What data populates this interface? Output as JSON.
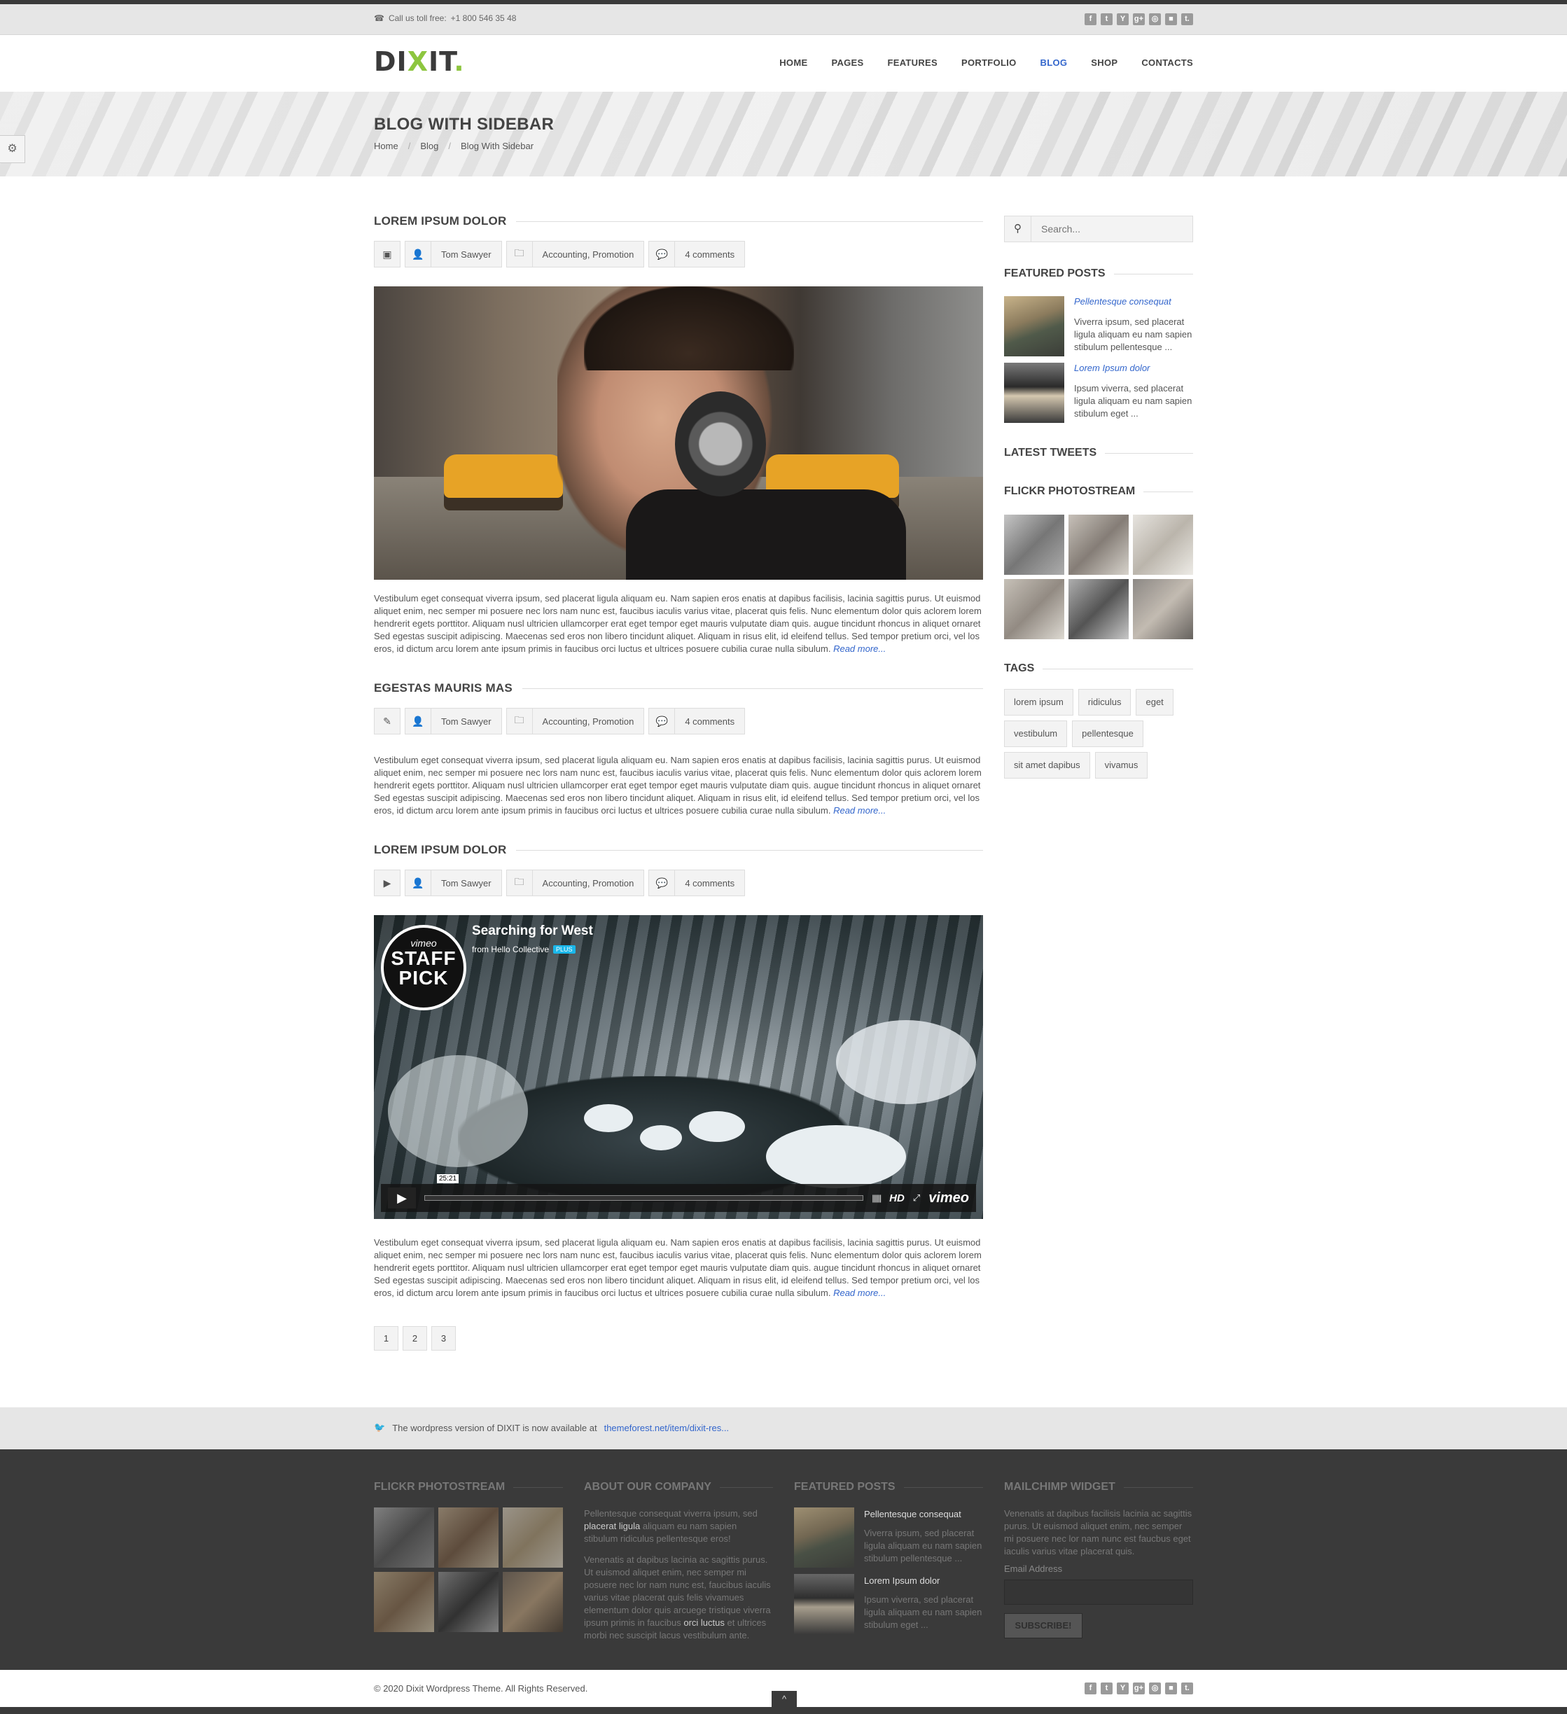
{
  "topbar": {
    "call_label": "Call us toll free:",
    "phone": "+1 800 546 35 48",
    "social": [
      {
        "icon": "facebook-icon",
        "glyph": "f"
      },
      {
        "icon": "twitter-icon",
        "glyph": "t"
      },
      {
        "icon": "youtube-icon",
        "glyph": "Y"
      },
      {
        "icon": "google-plus-icon",
        "glyph": "g+"
      },
      {
        "icon": "dribbble-icon",
        "glyph": "◎"
      },
      {
        "icon": "delicious-icon",
        "glyph": "■"
      },
      {
        "icon": "tumblr-icon",
        "glyph": "t."
      }
    ]
  },
  "header": {
    "logo": "DIXIT.",
    "nav": [
      "HOME",
      "PAGES",
      "FEATURES",
      "PORTFOLIO",
      "BLOG",
      "SHOP",
      "CONTACTS"
    ],
    "active_nav": "BLOG",
    "accent": "#3366cc",
    "brand_green": "#8dc63f"
  },
  "banner": {
    "title": "BLOG WITH SIDEBAR",
    "breadcrumb": [
      "Home",
      "Blog",
      "Blog With Sidebar"
    ]
  },
  "posts": [
    {
      "title": "LOREM IPSUM DOLOR",
      "format_icon": "image-icon",
      "author": "Tom Sawyer",
      "categories": "Accounting, Promotion",
      "comments": "4 comments",
      "excerpt": "Vestibulum eget consequat viverra ipsum, sed placerat ligula aliquam eu. Nam sapien eros enatis at dapibus facilisis, lacinia sagittis purus. Ut euismod aliquet enim, nec semper mi posuere nec lors nam nunc est, faucibus iaculis varius vitae, placerat quis felis. Nunc elementum dolor quis aclorem lorem hendrerit egets porttitor. Aliquam nusl ultricien ullamcorper erat eget tempor eget mauris vulputate diam quis. augue tincidunt rhoncus in aliquet ornaret Sed egestas suscipit adipiscing. Maecenas sed eros non libero tincidunt aliquet. Aliquam in risus elit, id eleifend tellus. Sed tempor pretium orci, vel los eros, id dictum arcu lorem ante ipsum primis in faucibus orci luctus et ultrices posuere cubilia curae nulla sibulum.",
      "read_more": "Read more..."
    },
    {
      "title": "EGESTAS MAURIS MAS",
      "format_icon": "pencil-icon",
      "author": "Tom Sawyer",
      "categories": "Accounting, Promotion",
      "comments": "4 comments",
      "excerpt": "Vestibulum eget consequat viverra ipsum, sed placerat ligula aliquam eu. Nam sapien eros enatis at dapibus facilisis, lacinia sagittis purus. Ut euismod aliquet enim, nec semper mi posuere nec lors nam nunc est, faucibus iaculis varius vitae, placerat quis felis. Nunc elementum dolor quis aclorem lorem hendrerit egets porttitor. Aliquam nusl ultricien ullamcorper erat eget tempor eget mauris vulputate diam quis. augue tincidunt rhoncus in aliquet ornaret Sed egestas suscipit adipiscing. Maecenas sed eros non libero tincidunt aliquet. Aliquam in risus elit, id eleifend tellus. Sed tempor pretium orci, vel los eros, id dictum arcu lorem ante ipsum primis in faucibus orci luctus et ultrices posuere cubilia curae nulla sibulum.",
      "read_more": "Read more..."
    },
    {
      "title": "LOREM IPSUM DOLOR",
      "format_icon": "play-icon",
      "author": "Tom Sawyer",
      "categories": "Accounting, Promotion",
      "comments": "4 comments",
      "excerpt": "Vestibulum eget consequat viverra ipsum, sed placerat ligula aliquam eu. Nam sapien eros enatis at dapibus facilisis, lacinia sagittis purus. Ut euismod aliquet enim, nec semper mi posuere nec lors nam nunc est, faucibus iaculis varius vitae, placerat quis felis. Nunc elementum dolor quis aclorem lorem hendrerit egets porttitor. Aliquam nusl ultricien ullamcorper erat eget tempor eget mauris vulputate diam quis. augue tincidunt rhoncus in aliquet ornaret Sed egestas suscipit adipiscing. Maecenas sed eros non libero tincidunt aliquet. Aliquam in risus elit, id eleifend tellus. Sed tempor pretium orci, vel los eros, id dictum arcu lorem ante ipsum primis in faucibus orci luctus et ultrices posuere cubilia curae nulla sibulum.",
      "read_more": "Read more..."
    }
  ],
  "video": {
    "title": "Searching for West",
    "from": "from Hello Collective",
    "plus_badge": "PLUS",
    "badge_brand": "vimeo",
    "badge_text": "STAFF PICK",
    "time": "25:21",
    "hd": "HD",
    "brand": "vimeo"
  },
  "pagination": [
    "1",
    "2",
    "3"
  ],
  "sidebar": {
    "search_placeholder": "Search...",
    "featured_title": "FEATURED POSTS",
    "featured": [
      {
        "title": "Pellentesque consequat",
        "desc": "Viverra ipsum, sed placerat ligula aliquam eu nam sapien stibulum pellentesque ..."
      },
      {
        "title": "Lorem Ipsum dolor",
        "desc": "Ipsum viverra, sed placerat ligula aliquam eu nam sapien stibulum eget ..."
      }
    ],
    "tweets_title": "LATEST TWEETS",
    "flickr_title": "FLICKR PHOTOSTREAM",
    "tags_title": "TAGS",
    "tags": [
      "lorem ipsum",
      "ridiculus",
      "eget",
      "vestibulum",
      "pellentesque",
      "sit amet dapibus",
      "vivamus"
    ]
  },
  "notice": {
    "text": "The wordpress version of DIXIT is now available at",
    "link": "themeforest.net/item/dixit-res..."
  },
  "footer": {
    "flickr_title": "FLICKR PHOTOSTREAM",
    "about_title": "ABOUT OUR COMPANY",
    "about_p1_a": "Pellentesque consequat viverra ipsum, sed",
    "about_p1_b": "placerat ligula",
    "about_p1_c": "aliquam eu nam sapien stibulum ridiculus pellentesque eros!",
    "about_p2_a": "Venenatis at dapibus lacinia ac sagittis purus. Ut euismod aliquet enim, nec semper mi posuere nec lor nam nunc est, faucibus iaculis varius vitae placerat quis felis vivamues elementum dolor quis arcuege tristique viverra ipsum primis in faucibus",
    "about_p2_b": "orci luctus",
    "about_p2_c": "et ultrices morbi nec suscipit lacus vestibulum ante.",
    "featured_title": "FEATURED POSTS",
    "featured": [
      {
        "title": "Pellentesque consequat",
        "desc": "Viverra ipsum, sed placerat ligula aliquam eu nam sapien stibulum pellentesque ..."
      },
      {
        "title": "Lorem Ipsum dolor",
        "desc": "Ipsum viverra, sed placerat ligula aliquam eu nam sapien stibulum eget ..."
      }
    ],
    "mailchimp_title": "MAILCHIMP WIDGET",
    "mailchimp_text": "Venenatis at dapibus facilisis lacinia ac sagittis purus. Ut euismod aliquet enim, nec semper mi posuere nec lor nam nunc est faucbus eget iaculis varius vitae placerat quis.",
    "email_label": "Email Address",
    "subscribe": "SUBSCRIBE!"
  },
  "bottom": {
    "copyright": "© 2020 Dixit Wordpress Theme. All Rights Reserved.",
    "to_top": "^"
  }
}
